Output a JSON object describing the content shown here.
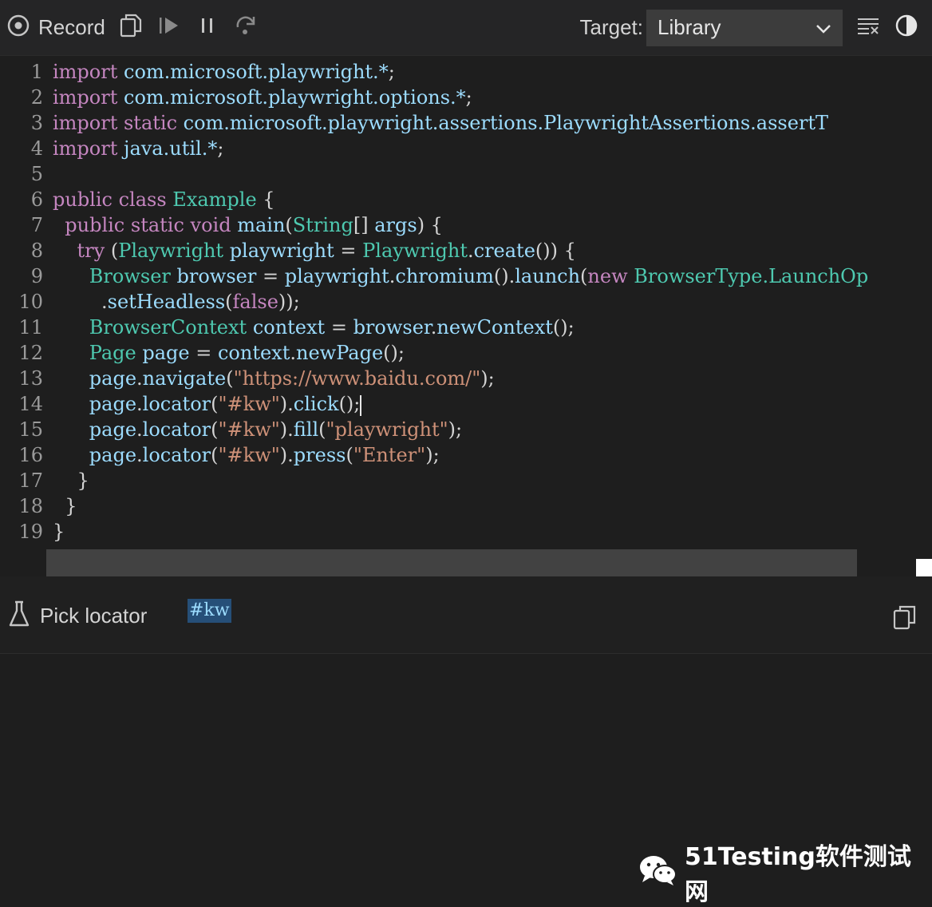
{
  "toolbar": {
    "record_label": "Record",
    "target_label": "Target:",
    "target_value": "Library",
    "icons": [
      "record-icon",
      "copy-icon",
      "resume-icon",
      "pause-icon",
      "step-over-icon",
      "clear-icon",
      "theme-toggle-icon"
    ]
  },
  "editor": {
    "line_numbers": [
      "1",
      "2",
      "3",
      "4",
      "5",
      "6",
      "7",
      "8",
      "9",
      "10",
      "11",
      "12",
      "13",
      "14",
      "15",
      "16",
      "17",
      "18",
      "19"
    ],
    "lines": [
      [
        [
          "kw",
          "import "
        ],
        [
          "id",
          "com.microsoft.playwright.*"
        ],
        [
          "pl",
          ";"
        ]
      ],
      [
        [
          "kw",
          "import "
        ],
        [
          "id",
          "com.microsoft.playwright.options.*"
        ],
        [
          "pl",
          ";"
        ]
      ],
      [
        [
          "kw",
          "import static "
        ],
        [
          "id",
          "com.microsoft.playwright.assertions.PlaywrightAssertions.assertT"
        ]
      ],
      [
        [
          "kw",
          "import "
        ],
        [
          "id",
          "java.util.*"
        ],
        [
          "pl",
          ";"
        ]
      ],
      [],
      [
        [
          "kw",
          "public class "
        ],
        [
          "ty",
          "Example"
        ],
        [
          "pl",
          " {"
        ]
      ],
      [
        [
          "pl",
          "  "
        ],
        [
          "kw",
          "public static void "
        ],
        [
          "id",
          "main"
        ],
        [
          "pl",
          "("
        ],
        [
          "ty",
          "String"
        ],
        [
          "pl",
          "[] "
        ],
        [
          "id",
          "args"
        ],
        [
          "pl",
          ") {"
        ]
      ],
      [
        [
          "pl",
          "    "
        ],
        [
          "kw",
          "try "
        ],
        [
          "pl",
          "("
        ],
        [
          "ty",
          "Playwright "
        ],
        [
          "id",
          "playwright"
        ],
        [
          "pl",
          " = "
        ],
        [
          "ty",
          "Playwright"
        ],
        [
          "pl",
          "."
        ],
        [
          "id",
          "create"
        ],
        [
          "pl",
          "()) {"
        ]
      ],
      [
        [
          "pl",
          "      "
        ],
        [
          "ty",
          "Browser "
        ],
        [
          "id",
          "browser"
        ],
        [
          "pl",
          " = "
        ],
        [
          "id",
          "playwright"
        ],
        [
          "pl",
          "."
        ],
        [
          "id",
          "chromium"
        ],
        [
          "pl",
          "()."
        ],
        [
          "id",
          "launch"
        ],
        [
          "pl",
          "("
        ],
        [
          "kw",
          "new "
        ],
        [
          "ty",
          "BrowserType.LaunchOp"
        ]
      ],
      [
        [
          "pl",
          "        ."
        ],
        [
          "id",
          "setHeadless"
        ],
        [
          "pl",
          "("
        ],
        [
          "kw",
          "false"
        ],
        [
          "pl",
          "));"
        ]
      ],
      [
        [
          "pl",
          "      "
        ],
        [
          "ty",
          "BrowserContext "
        ],
        [
          "id",
          "context"
        ],
        [
          "pl",
          " = "
        ],
        [
          "id",
          "browser"
        ],
        [
          "pl",
          "."
        ],
        [
          "id",
          "newContext"
        ],
        [
          "pl",
          "();"
        ]
      ],
      [
        [
          "pl",
          "      "
        ],
        [
          "ty",
          "Page "
        ],
        [
          "id",
          "page"
        ],
        [
          "pl",
          " = "
        ],
        [
          "id",
          "context"
        ],
        [
          "pl",
          "."
        ],
        [
          "id",
          "newPage"
        ],
        [
          "pl",
          "();"
        ]
      ],
      [
        [
          "pl",
          "      "
        ],
        [
          "id",
          "page"
        ],
        [
          "pl",
          "."
        ],
        [
          "id",
          "navigate"
        ],
        [
          "pl",
          "("
        ],
        [
          "str",
          "\"https://www.baidu.com/\""
        ],
        [
          "pl",
          ");"
        ]
      ],
      [
        [
          "pl",
          "      "
        ],
        [
          "id",
          "page"
        ],
        [
          "pl",
          "."
        ],
        [
          "id",
          "locator"
        ],
        [
          "pl",
          "("
        ],
        [
          "str",
          "\"#kw\""
        ],
        [
          "pl",
          ")."
        ],
        [
          "id",
          "click"
        ],
        [
          "pl",
          "();"
        ],
        [
          "cursor",
          ""
        ]
      ],
      [
        [
          "pl",
          "      "
        ],
        [
          "id",
          "page"
        ],
        [
          "pl",
          "."
        ],
        [
          "id",
          "locator"
        ],
        [
          "pl",
          "("
        ],
        [
          "str",
          "\"#kw\""
        ],
        [
          "pl",
          ")."
        ],
        [
          "id",
          "fill"
        ],
        [
          "pl",
          "("
        ],
        [
          "str",
          "\"playwright\""
        ],
        [
          "pl",
          ");"
        ]
      ],
      [
        [
          "pl",
          "      "
        ],
        [
          "id",
          "page"
        ],
        [
          "pl",
          "."
        ],
        [
          "id",
          "locator"
        ],
        [
          "pl",
          "("
        ],
        [
          "str",
          "\"#kw\""
        ],
        [
          "pl",
          ")."
        ],
        [
          "id",
          "press"
        ],
        [
          "pl",
          "("
        ],
        [
          "str",
          "\"Enter\""
        ],
        [
          "pl",
          ");"
        ]
      ],
      [
        [
          "pl",
          "    }"
        ]
      ],
      [
        [
          "pl",
          "  }"
        ]
      ],
      [
        [
          "pl",
          "}"
        ]
      ]
    ]
  },
  "locator": {
    "pick_label": "Pick locator",
    "value": "#kw"
  },
  "watermark": {
    "text": "51Testing软件测试网"
  },
  "colors": {
    "keyword": "#c586c0",
    "identifier": "#9cdcfe",
    "type": "#4ec9b0",
    "string": "#ce9178",
    "background": "#1e1e1e"
  }
}
